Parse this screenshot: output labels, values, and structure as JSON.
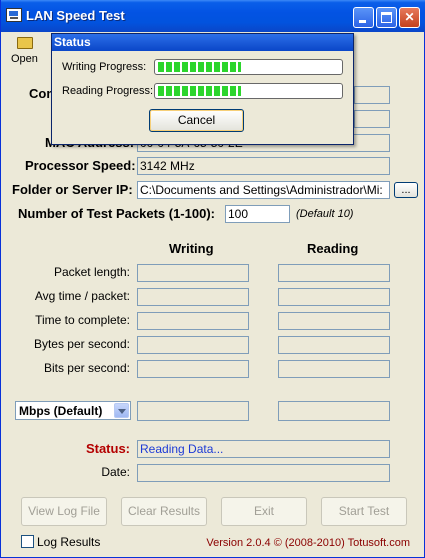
{
  "window": {
    "title": "LAN Speed Test"
  },
  "toolbar": {
    "open_label": "Open"
  },
  "info": {
    "computer_label": "Com",
    "mac_label": "MAC Address:",
    "mac_value": "00-04-5A-65-50-2E",
    "processor_label": "Processor Speed:",
    "processor_value": "3142 MHz",
    "folder_label": "Folder or Server IP:",
    "folder_value": "C:\\Documents and Settings\\Administrador\\Mi:",
    "browse_label": "...",
    "packets_label": "Number of Test Packets (1-100):",
    "packets_value": "100",
    "packets_note": "(Default 10)"
  },
  "results": {
    "writing_header": "Writing",
    "reading_header": "Reading",
    "rows": [
      {
        "label": "Packet length:"
      },
      {
        "label": "Avg time / packet:"
      },
      {
        "label": "Time to complete:"
      },
      {
        "label": "Bytes per second:"
      },
      {
        "label": "Bits per second:"
      }
    ],
    "unit_select": "Mbps (Default)"
  },
  "status": {
    "label": "Status:",
    "value": "Reading Data...",
    "date_label": "Date:",
    "date_value": ""
  },
  "buttons": {
    "view_log": "View Log File",
    "clear": "Clear Results",
    "exit": "Exit",
    "start": "Start Test"
  },
  "footer": {
    "log_results": "Log Results",
    "version": "Version 2.0.4  © (2008-2010) Totusoft.com"
  },
  "dialog": {
    "title": "Status",
    "writing_label": "Writing Progress:",
    "writing_progress": 0.46,
    "reading_label": "Reading Progress:",
    "reading_progress": 0.46,
    "cancel_label": "Cancel"
  },
  "colors": {
    "status_label": "#b40000",
    "status_text": "#1d3bd6",
    "progress": "#2cd52c"
  }
}
